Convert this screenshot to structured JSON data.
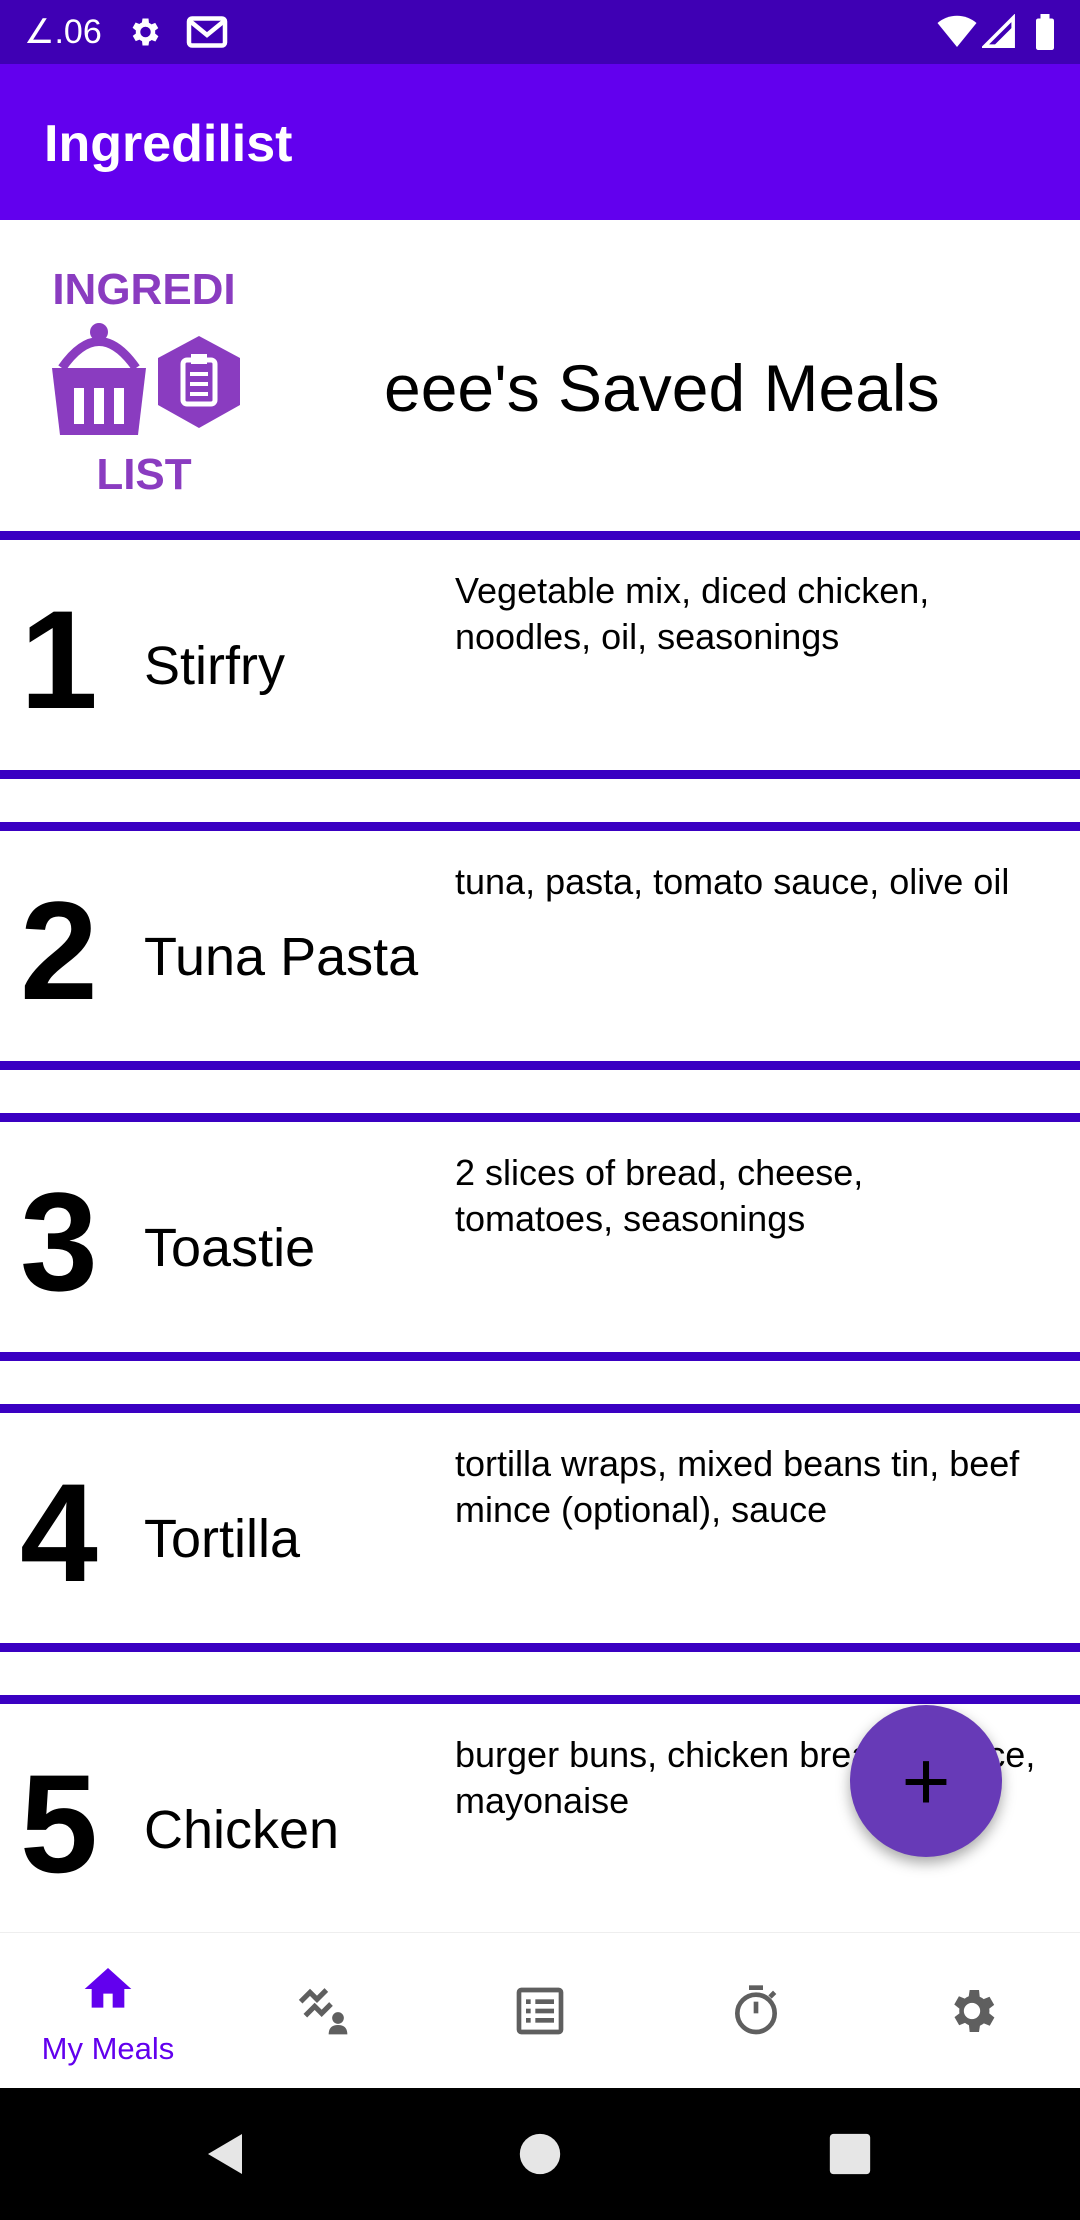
{
  "status_bar": {
    "time": "∠.06",
    "icons": [
      "gear-icon",
      "gmail-icon",
      "wifi-icon",
      "signal-icon",
      "battery-icon"
    ]
  },
  "app_bar": {
    "title": "Ingredilist",
    "color": "#6200ee"
  },
  "header": {
    "logo_top": "INGREDI",
    "logo_bottom": "LIST",
    "title": "eee's Saved Meals"
  },
  "meals": [
    {
      "number": "1",
      "name": "Stirfry",
      "ingredients": "Vegetable mix, diced chicken, noodles, oil, seasonings"
    },
    {
      "number": "2",
      "name": "Tuna Pasta",
      "ingredients": "tuna, pasta, tomato sauce, olive oil"
    },
    {
      "number": "3",
      "name": "Toastie",
      "ingredients": "2 slices of bread, cheese, tomatoes, seasonings"
    },
    {
      "number": "4",
      "name": "Tortilla",
      "ingredients": "tortilla wraps, mixed beans tin, beef mince (optional), sauce"
    },
    {
      "number": "5",
      "name": "Chicken",
      "ingredients": "burger buns, chicken breast, lettuce, mayonaise"
    }
  ],
  "fab": {
    "icon": "+"
  },
  "bottom_nav": {
    "items": [
      {
        "label": "My Meals",
        "icon": "home-icon",
        "active": true
      },
      {
        "label": "",
        "icon": "activity-icon",
        "active": false
      },
      {
        "label": "",
        "icon": "list-icon",
        "active": false
      },
      {
        "label": "",
        "icon": "timer-icon",
        "active": false
      },
      {
        "label": "",
        "icon": "settings-icon",
        "active": false
      }
    ]
  },
  "colors": {
    "accent": "#6200ee",
    "status_bar": "#3f00b4",
    "divider": "#3a00c2",
    "fab": "#673ab7"
  }
}
